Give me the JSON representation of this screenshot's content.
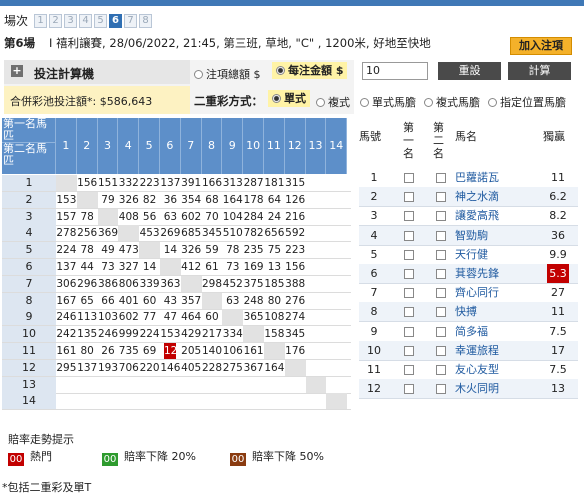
{
  "race_selector": {
    "label": "場次",
    "races": [
      "1",
      "2",
      "3",
      "4",
      "5",
      "6",
      "7",
      "8"
    ],
    "active": "6"
  },
  "race_info": {
    "race_no": "第6場",
    "details": "I 禧利讓賽, 28/06/2022, 21:45, 第三班, 草地, \"C\" , 1200米, 好地至快地"
  },
  "add_button": "加入注項",
  "calc": {
    "title": "投注計算機",
    "option_total": "注項總額 $",
    "option_unit": "每注金額 $",
    "amount": "10",
    "reset": "重設",
    "compute": "計算",
    "pool_label": "合併彩池投注額*: $586,643"
  },
  "mode": {
    "label": "二重彩方式：",
    "options": [
      "單式",
      "複式",
      "單式馬膽",
      "複式馬膽",
      "指定位置馬膽"
    ],
    "selected": "單式"
  },
  "matrix": {
    "corner_top": "第一名馬匹",
    "corner_bottom": "第二名馬匹",
    "columns": [
      "1",
      "2",
      "3",
      "4",
      "5",
      "6",
      "7",
      "8",
      "9",
      "10",
      "11",
      "12",
      "13",
      "14"
    ],
    "rows": [
      {
        "label": "1",
        "cells": [
          "",
          "156",
          "151",
          "332",
          "223",
          "137",
          "391",
          "166",
          "313",
          "287",
          "181",
          "315",
          "",
          ""
        ]
      },
      {
        "label": "2",
        "cells": [
          "153",
          "",
          "79",
          "326",
          "82",
          "36",
          "354",
          "68",
          "164",
          "178",
          "64",
          "126",
          "",
          ""
        ]
      },
      {
        "label": "3",
        "cells": [
          "157",
          "78",
          "",
          "408",
          "56",
          "63",
          "602",
          "70",
          "104",
          "284",
          "24",
          "216",
          "",
          ""
        ]
      },
      {
        "label": "4",
        "cells": [
          "278",
          "256",
          "369",
          "",
          "453",
          "269",
          "685",
          "345",
          "510",
          "782",
          "656",
          "592",
          "",
          ""
        ]
      },
      {
        "label": "5",
        "cells": [
          "224",
          "78",
          "49",
          "473",
          "",
          "14",
          "326",
          "59",
          "78",
          "235",
          "75",
          "223",
          "",
          ""
        ]
      },
      {
        "label": "6",
        "cells": [
          "137",
          "44",
          "73",
          "327",
          "14",
          "",
          "412",
          "61",
          "73",
          "169",
          "13",
          "156",
          "",
          ""
        ]
      },
      {
        "label": "7",
        "cells": [
          "306",
          "296",
          "386",
          "806",
          "339",
          "363",
          "",
          "298",
          "452",
          "375",
          "185",
          "388",
          "",
          ""
        ]
      },
      {
        "label": "8",
        "cells": [
          "167",
          "65",
          "66",
          "401",
          "60",
          "43",
          "357",
          "",
          "63",
          "248",
          "80",
          "276",
          "",
          ""
        ]
      },
      {
        "label": "9",
        "cells": [
          "246",
          "113",
          "103",
          "602",
          "77",
          "47",
          "464",
          "60",
          "",
          "365",
          "108",
          "274",
          "",
          ""
        ]
      },
      {
        "label": "10",
        "cells": [
          "242",
          "135",
          "246",
          "999",
          "224",
          "153",
          "429",
          "217",
          "334",
          "",
          "158",
          "345",
          "",
          ""
        ]
      },
      {
        "label": "11",
        "cells": [
          "161",
          "80",
          "26",
          "735",
          "69",
          "12",
          "205",
          "140",
          "106",
          "161",
          "",
          "176",
          "",
          ""
        ]
      },
      {
        "label": "12",
        "cells": [
          "295",
          "137",
          "193",
          "706",
          "220",
          "146",
          "405",
          "228",
          "275",
          "367",
          "164",
          "",
          "",
          ""
        ]
      },
      {
        "label": "13",
        "cells": [
          "",
          "",
          "",
          "",
          "",
          "",
          "",
          "",
          "",
          "",
          "",
          "",
          "",
          ""
        ]
      },
      {
        "label": "14",
        "cells": [
          "",
          "",
          "",
          "",
          "",
          "",
          "",
          "",
          "",
          "",
          "",
          "",
          "",
          ""
        ]
      }
    ],
    "hot_cell": {
      "row": "11",
      "col": "6"
    }
  },
  "runners": {
    "headers": {
      "no": "馬號",
      "first": "第一名",
      "second": "第二名",
      "name": "馬名",
      "win": "獨贏"
    },
    "rows": [
      {
        "no": "1",
        "name": "巴蘿諾瓦",
        "win": "11"
      },
      {
        "no": "2",
        "name": "神之水滴",
        "win": "6.2"
      },
      {
        "no": "3",
        "name": "讓愛高飛",
        "win": "8.2"
      },
      {
        "no": "4",
        "name": "智勁駒",
        "win": "36"
      },
      {
        "no": "5",
        "name": "天行健",
        "win": "9.9"
      },
      {
        "no": "6",
        "name": "萁蓉先鋒",
        "win": "5.3",
        "hot": true
      },
      {
        "no": "7",
        "name": "齊心同行",
        "win": "27"
      },
      {
        "no": "8",
        "name": "快搏",
        "win": "11"
      },
      {
        "no": "9",
        "name": "简多福",
        "win": "7.5"
      },
      {
        "no": "10",
        "name": "幸運旅程",
        "win": "17"
      },
      {
        "no": "11",
        "name": "友心友型",
        "win": "7.5"
      },
      {
        "no": "12",
        "name": "木火同明",
        "win": "13"
      }
    ]
  },
  "legend": {
    "title": "賠率走勢提示",
    "items": [
      {
        "swatch": "00",
        "label": "熱門",
        "color": "#c20000"
      },
      {
        "swatch": "00",
        "label": "賠率下降 20%",
        "color": "#2e9b2e"
      },
      {
        "swatch": "00",
        "label": "賠率下降 50%",
        "color": "#8a3b10"
      }
    ]
  },
  "footnote": "*包括二重彩及單T"
}
